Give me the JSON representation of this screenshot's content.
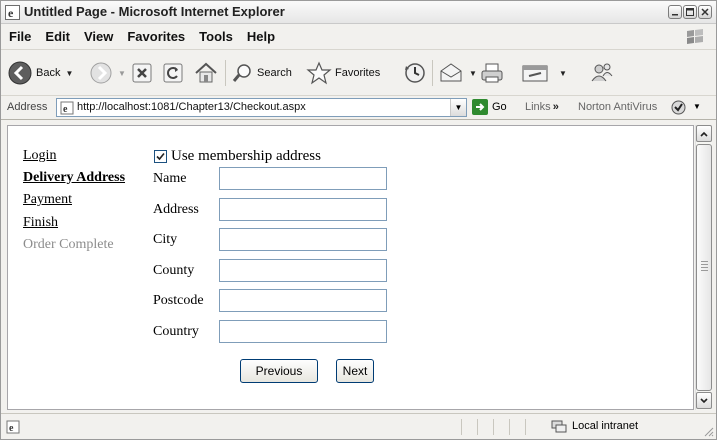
{
  "window": {
    "title": "Untitled Page - Microsoft Internet Explorer",
    "controls": [
      "minimize-icon",
      "maximize-icon",
      "close-icon"
    ]
  },
  "menu": {
    "items": [
      "File",
      "Edit",
      "View",
      "Favorites",
      "Tools",
      "Help"
    ]
  },
  "toolbar": {
    "back_label": "Back",
    "search_label": "Search",
    "favorites_label": "Favorites"
  },
  "address_bar": {
    "label": "Address",
    "url": "http://localhost:1081/Chapter13/Checkout.aspx",
    "go_label": "Go",
    "links_label": "Links",
    "chevron": "»",
    "norton_label": "Norton AntiVirus"
  },
  "page": {
    "nav": {
      "login": "Login",
      "delivery_address": "Delivery Address",
      "payment": "Payment",
      "finish": "Finish",
      "order_complete": "Order Complete"
    },
    "use_membership_label": "Use membership address",
    "use_membership_checked": true,
    "fields": {
      "name": {
        "label": "Name",
        "value": ""
      },
      "address": {
        "label": "Address",
        "value": ""
      },
      "city": {
        "label": "City",
        "value": ""
      },
      "county": {
        "label": "County",
        "value": ""
      },
      "postcode": {
        "label": "Postcode",
        "value": ""
      },
      "country": {
        "label": "Country",
        "value": ""
      }
    },
    "buttons": {
      "previous": "Previous",
      "next": "Next"
    }
  },
  "status_bar": {
    "zone": "Local intranet"
  },
  "colors": {
    "link": "#000000",
    "disabled": "#8c8c8c",
    "input_border": "#7f9db9",
    "go_green": "#2f8a2f"
  }
}
